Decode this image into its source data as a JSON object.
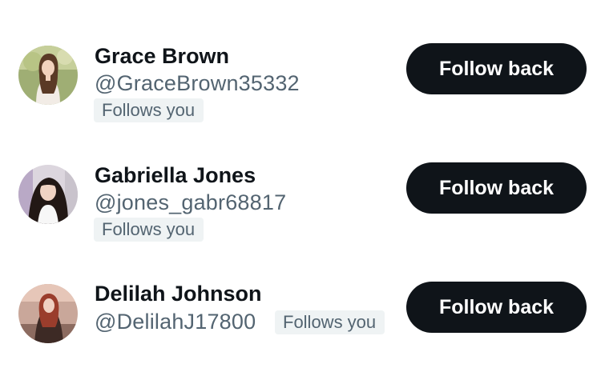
{
  "users": [
    {
      "name": "Grace Brown",
      "handle": "@GraceBrown35332",
      "follows_badge": "Follows you",
      "button_label": "Follow back"
    },
    {
      "name": "Gabriella Jones",
      "handle": "@jones_gabr68817",
      "follows_badge": "Follows you",
      "button_label": "Follow back"
    },
    {
      "name": "Delilah Johnson",
      "handle": "@DelilahJ17800",
      "follows_badge": "Follows you",
      "button_label": "Follow back"
    }
  ],
  "colors": {
    "name_text": "#0f1419",
    "secondary_text": "#536471",
    "badge_bg": "#eff3f4",
    "button_bg": "#0f1419",
    "button_text": "#ffffff"
  }
}
